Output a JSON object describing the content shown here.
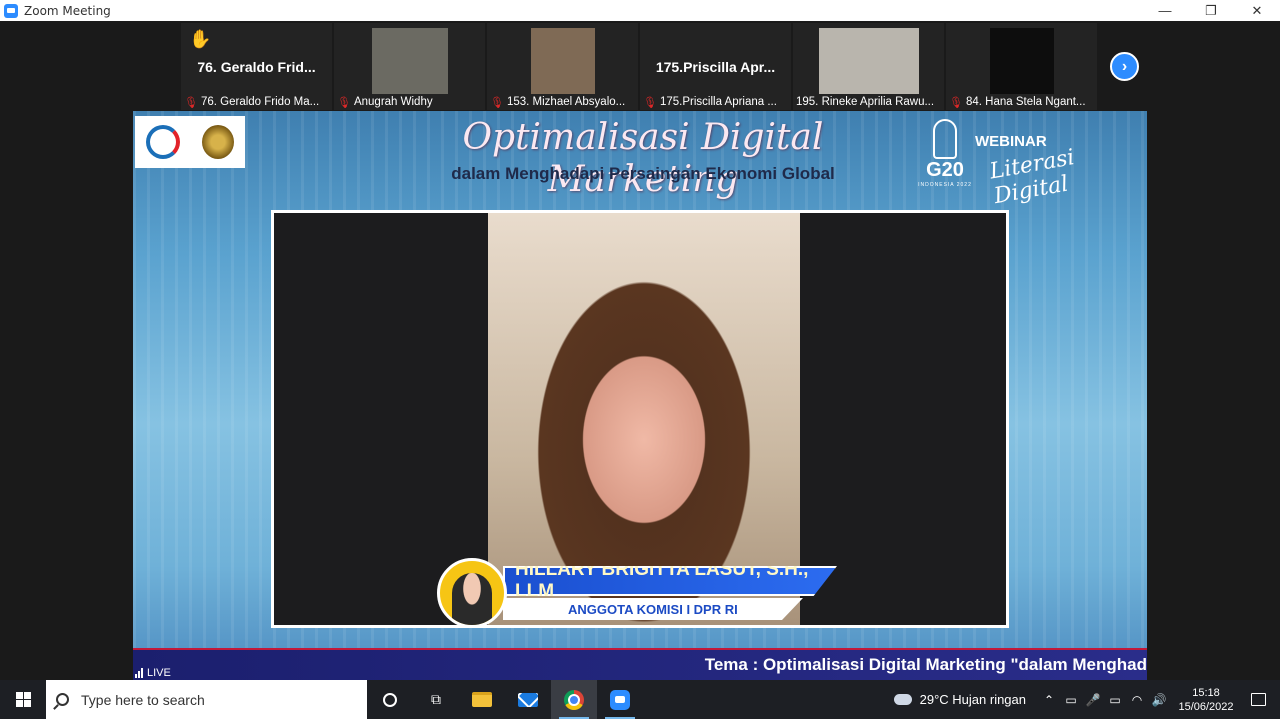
{
  "window": {
    "title": "Zoom Meeting",
    "controls": {
      "minimize": "—",
      "restore": "❐",
      "close": "✕"
    }
  },
  "thumbnails": [
    {
      "big_name": "76. Geraldo Frid...",
      "label": "76. Geraldo Frido Ma...",
      "muted": true,
      "has_video": false,
      "raised_hand": true
    },
    {
      "big_name": "",
      "label": "Anugrah Widhy",
      "muted": true,
      "has_video": true,
      "video_color": "#6b6a62"
    },
    {
      "big_name": "",
      "label": "153. Mizhael Absyalo...",
      "muted": true,
      "has_video": true,
      "video_color": "#7f6a55"
    },
    {
      "big_name": "175.Priscilla Apr...",
      "label": "175.Priscilla Apriana ...",
      "muted": true,
      "has_video": false
    },
    {
      "big_name": "",
      "label": "195. Rineke Aprilia Rawu...",
      "muted": false,
      "has_video": true,
      "video_color": "#b9b5ad"
    },
    {
      "big_name": "",
      "label": "84. Hana Stela Ngant...",
      "muted": true,
      "has_video": true,
      "video_color": "#0d0d0d"
    }
  ],
  "next_button_icon": "chevron-right-icon",
  "banner": {
    "headline": "Optimalisasi Digital Marketing",
    "subhead": "dalam Menghadapi Persaingan Ekonomi Global",
    "g20_text": "G20",
    "g20_sub": "INDONESIA 2022",
    "webinar": "WEBINAR",
    "literasi": "Literasi Digital"
  },
  "speaker": {
    "name": "HILLARY BRIGITTA LASUT, S.H., LLM",
    "role": "ANGGOTA KOMISI I DPR RI"
  },
  "ticker": "Tema : Optimalisasi Digital Marketing \"dalam Menghad",
  "live_label": "LIVE",
  "taskbar": {
    "search_placeholder": "Type here to search",
    "weather": "29°C  Hujan ringan",
    "time": "15:18",
    "date": "15/06/2022"
  },
  "colors": {
    "zoom_blue": "#2d8cff",
    "mute_red": "#e02828",
    "ticker_bg": "#1b1f6e",
    "name_bar": "#1a4fd0"
  }
}
